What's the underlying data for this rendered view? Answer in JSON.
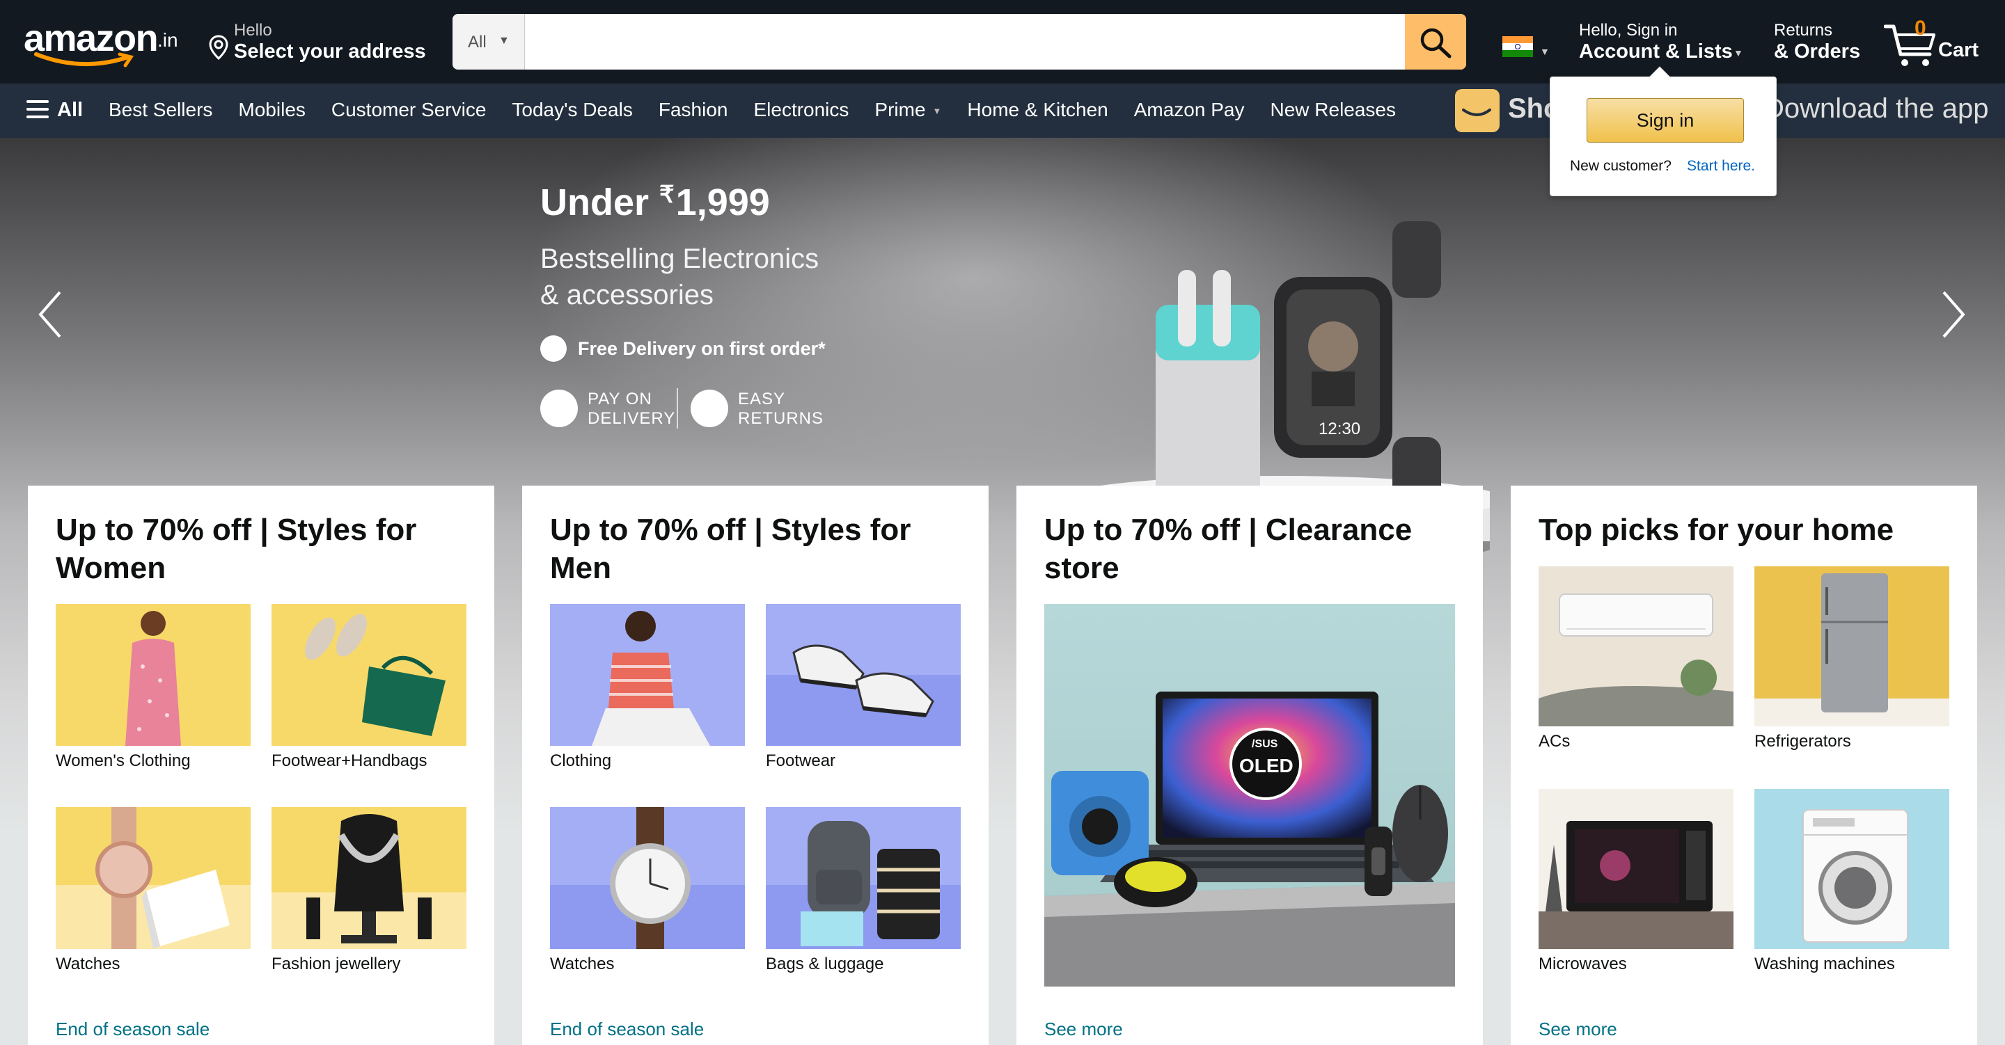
{
  "header": {
    "logo_text": "amazon",
    "logo_tld": ".in",
    "address_hello": "Hello",
    "address_select": "Select your address",
    "search_category": "All",
    "search_placeholder": "",
    "account_hello": "Hello, Sign in",
    "account_lists": "Account & Lists",
    "returns": "Returns",
    "orders": "& Orders",
    "cart_count": "0",
    "cart_label": "Cart"
  },
  "subnav": {
    "all_label": "All",
    "links": [
      "Best Sellers",
      "Mobiles",
      "Customer Service",
      "Today's Deals",
      "Fashion",
      "Electronics",
      "Prime",
      "Home & Kitchen",
      "Amazon Pay",
      "New Releases"
    ],
    "promo_left": "Sho",
    "promo_right": "Download the app"
  },
  "hero": {
    "headline_prefix": "Under ",
    "currency": "₹",
    "price": "1,999",
    "sub_line1": "Bestselling Electronics",
    "sub_line2": "& accessories",
    "free_delivery": "Free Delivery on first order*",
    "pod_1": "PAY ON",
    "pod_2": "DELIVERY",
    "returns_1": "EASY",
    "returns_2": "RETURNS",
    "watch_time": "12:30"
  },
  "signin_popover": {
    "button": "Sign in",
    "new_customer": "New customer?",
    "start_here": "Start here."
  },
  "cards": [
    {
      "title": "Up to 70% off | Styles for Women",
      "tiles": [
        "Women's Clothing",
        "Footwear+Handbags",
        "Watches",
        "Fashion jewellery"
      ],
      "link": "End of season sale"
    },
    {
      "title": "Up to 70% off | Styles for Men",
      "tiles": [
        "Clothing",
        "Footwear",
        "Watches",
        "Bags & luggage"
      ],
      "link": "End of season sale"
    },
    {
      "title": "Up to 70% off | Clearance store",
      "laptop_badge_brand": "/SUS",
      "laptop_badge": "OLED",
      "link": "See more"
    },
    {
      "title": "Top picks for your home",
      "tiles": [
        "ACs",
        "Refrigerators",
        "Microwaves",
        "Washing machines"
      ],
      "link": "See more"
    }
  ],
  "colors": {
    "nav_bg": "#131921",
    "subnav_bg": "#232f3e",
    "search_button": "#febd69",
    "cart_count": "#f08804",
    "link": "#007185",
    "signin_button": "#f0c14b"
  },
  "icons": [
    "location-pin-icon",
    "search-icon",
    "india-flag-icon",
    "cart-icon",
    "hamburger-icon",
    "chevron-left-icon",
    "chevron-right-icon"
  ]
}
